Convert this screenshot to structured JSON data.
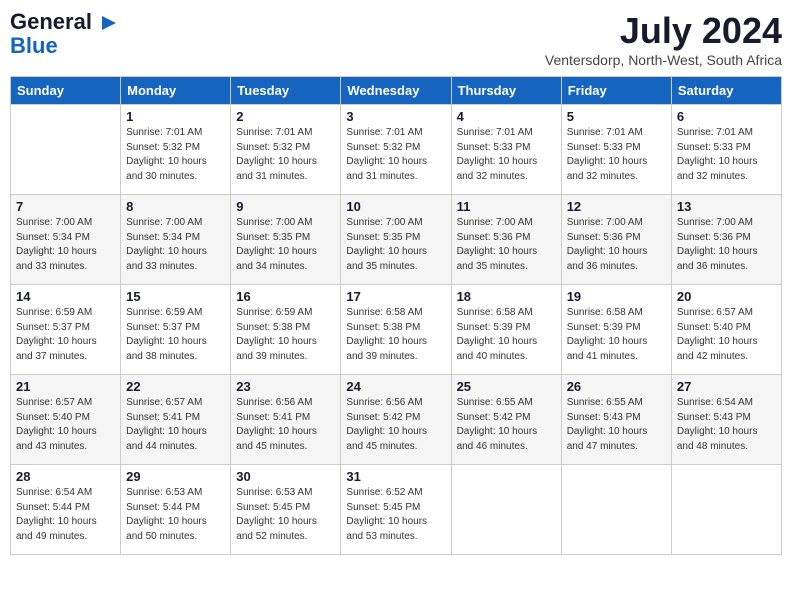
{
  "logo": {
    "line1": "General",
    "line2": "Blue"
  },
  "title": "July 2024",
  "location": "Ventersdorp, North-West, South Africa",
  "days_of_week": [
    "Sunday",
    "Monday",
    "Tuesday",
    "Wednesday",
    "Thursday",
    "Friday",
    "Saturday"
  ],
  "weeks": [
    [
      {
        "day": "",
        "info": ""
      },
      {
        "day": "1",
        "info": "Sunrise: 7:01 AM\nSunset: 5:32 PM\nDaylight: 10 hours\nand 30 minutes."
      },
      {
        "day": "2",
        "info": "Sunrise: 7:01 AM\nSunset: 5:32 PM\nDaylight: 10 hours\nand 31 minutes."
      },
      {
        "day": "3",
        "info": "Sunrise: 7:01 AM\nSunset: 5:32 PM\nDaylight: 10 hours\nand 31 minutes."
      },
      {
        "day": "4",
        "info": "Sunrise: 7:01 AM\nSunset: 5:33 PM\nDaylight: 10 hours\nand 32 minutes."
      },
      {
        "day": "5",
        "info": "Sunrise: 7:01 AM\nSunset: 5:33 PM\nDaylight: 10 hours\nand 32 minutes."
      },
      {
        "day": "6",
        "info": "Sunrise: 7:01 AM\nSunset: 5:33 PM\nDaylight: 10 hours\nand 32 minutes."
      }
    ],
    [
      {
        "day": "7",
        "info": "Sunrise: 7:00 AM\nSunset: 5:34 PM\nDaylight: 10 hours\nand 33 minutes."
      },
      {
        "day": "8",
        "info": "Sunrise: 7:00 AM\nSunset: 5:34 PM\nDaylight: 10 hours\nand 33 minutes."
      },
      {
        "day": "9",
        "info": "Sunrise: 7:00 AM\nSunset: 5:35 PM\nDaylight: 10 hours\nand 34 minutes."
      },
      {
        "day": "10",
        "info": "Sunrise: 7:00 AM\nSunset: 5:35 PM\nDaylight: 10 hours\nand 35 minutes."
      },
      {
        "day": "11",
        "info": "Sunrise: 7:00 AM\nSunset: 5:36 PM\nDaylight: 10 hours\nand 35 minutes."
      },
      {
        "day": "12",
        "info": "Sunrise: 7:00 AM\nSunset: 5:36 PM\nDaylight: 10 hours\nand 36 minutes."
      },
      {
        "day": "13",
        "info": "Sunrise: 7:00 AM\nSunset: 5:36 PM\nDaylight: 10 hours\nand 36 minutes."
      }
    ],
    [
      {
        "day": "14",
        "info": "Sunrise: 6:59 AM\nSunset: 5:37 PM\nDaylight: 10 hours\nand 37 minutes."
      },
      {
        "day": "15",
        "info": "Sunrise: 6:59 AM\nSunset: 5:37 PM\nDaylight: 10 hours\nand 38 minutes."
      },
      {
        "day": "16",
        "info": "Sunrise: 6:59 AM\nSunset: 5:38 PM\nDaylight: 10 hours\nand 39 minutes."
      },
      {
        "day": "17",
        "info": "Sunrise: 6:58 AM\nSunset: 5:38 PM\nDaylight: 10 hours\nand 39 minutes."
      },
      {
        "day": "18",
        "info": "Sunrise: 6:58 AM\nSunset: 5:39 PM\nDaylight: 10 hours\nand 40 minutes."
      },
      {
        "day": "19",
        "info": "Sunrise: 6:58 AM\nSunset: 5:39 PM\nDaylight: 10 hours\nand 41 minutes."
      },
      {
        "day": "20",
        "info": "Sunrise: 6:57 AM\nSunset: 5:40 PM\nDaylight: 10 hours\nand 42 minutes."
      }
    ],
    [
      {
        "day": "21",
        "info": "Sunrise: 6:57 AM\nSunset: 5:40 PM\nDaylight: 10 hours\nand 43 minutes."
      },
      {
        "day": "22",
        "info": "Sunrise: 6:57 AM\nSunset: 5:41 PM\nDaylight: 10 hours\nand 44 minutes."
      },
      {
        "day": "23",
        "info": "Sunrise: 6:56 AM\nSunset: 5:41 PM\nDaylight: 10 hours\nand 45 minutes."
      },
      {
        "day": "24",
        "info": "Sunrise: 6:56 AM\nSunset: 5:42 PM\nDaylight: 10 hours\nand 45 minutes."
      },
      {
        "day": "25",
        "info": "Sunrise: 6:55 AM\nSunset: 5:42 PM\nDaylight: 10 hours\nand 46 minutes."
      },
      {
        "day": "26",
        "info": "Sunrise: 6:55 AM\nSunset: 5:43 PM\nDaylight: 10 hours\nand 47 minutes."
      },
      {
        "day": "27",
        "info": "Sunrise: 6:54 AM\nSunset: 5:43 PM\nDaylight: 10 hours\nand 48 minutes."
      }
    ],
    [
      {
        "day": "28",
        "info": "Sunrise: 6:54 AM\nSunset: 5:44 PM\nDaylight: 10 hours\nand 49 minutes."
      },
      {
        "day": "29",
        "info": "Sunrise: 6:53 AM\nSunset: 5:44 PM\nDaylight: 10 hours\nand 50 minutes."
      },
      {
        "day": "30",
        "info": "Sunrise: 6:53 AM\nSunset: 5:45 PM\nDaylight: 10 hours\nand 52 minutes."
      },
      {
        "day": "31",
        "info": "Sunrise: 6:52 AM\nSunset: 5:45 PM\nDaylight: 10 hours\nand 53 minutes."
      },
      {
        "day": "",
        "info": ""
      },
      {
        "day": "",
        "info": ""
      },
      {
        "day": "",
        "info": ""
      }
    ]
  ]
}
